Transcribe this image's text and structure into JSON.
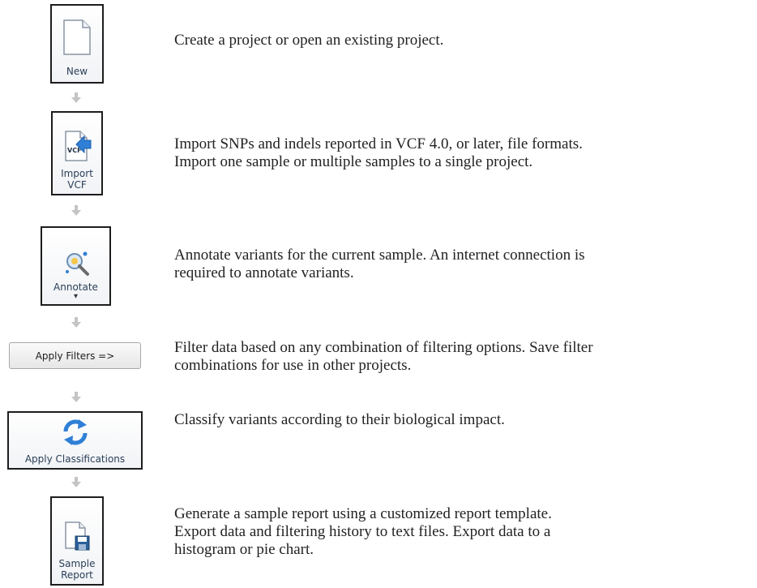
{
  "steps": [
    {
      "button_label": "New",
      "icon": "blank-document-icon",
      "lines": [
        "Create a project or open an existing project."
      ]
    },
    {
      "button_label_1": "Import",
      "button_label_2": "VCF",
      "icon": "import-vcf-icon",
      "icon_text": "VCF",
      "lines": [
        "Import SNPs and indels reported in VCF 4.0, or later, file formats.",
        "Import one sample or multiple samples to a single project."
      ]
    },
    {
      "button_label": "Annotate",
      "dropdown_glyph": "▾",
      "icon": "magnifier-sparkle-icon",
      "lines": [
        "Annotate variants for the current sample. An internet connection is",
        "required to annotate variants."
      ]
    },
    {
      "button_label": "Apply Filters =>",
      "lines": [
        "Filter data based on any combination of filtering options. Save filter",
        "combinations for use in other projects."
      ]
    },
    {
      "button_label": "Apply Classifications",
      "icon": "refresh-arrows-icon",
      "lines": [
        "Classify variants according to their biological impact."
      ]
    },
    {
      "button_label_1": "Sample",
      "button_label_2": "Report",
      "icon": "save-document-icon",
      "lines": [
        "Generate a sample report using a customized report template.",
        "Export data and filtering history to text files. Export data to a",
        "histogram or pie chart."
      ]
    }
  ],
  "colors": {
    "frame": "#1d1d1d",
    "button_border": "#9aa3ad",
    "label": "#2a3f58",
    "arrow": "#c4c4c4",
    "icon_blue": "#2f7fd6"
  }
}
